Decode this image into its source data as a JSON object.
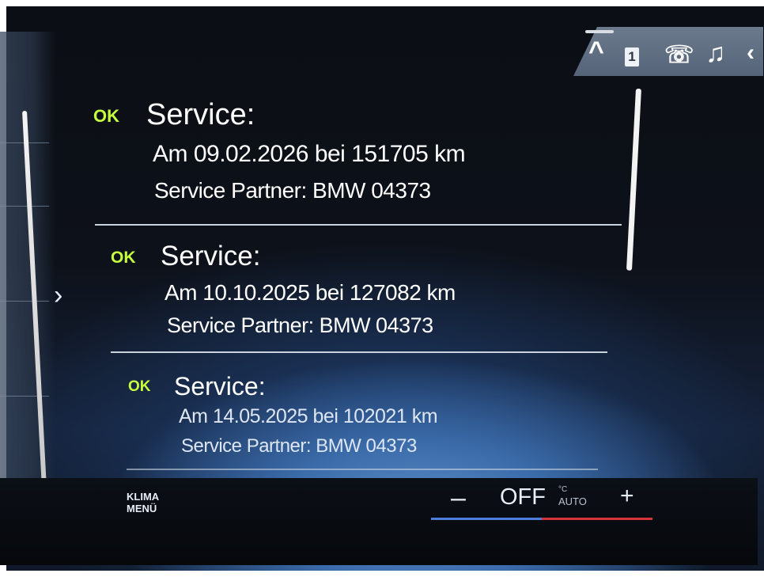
{
  "top_bar": {
    "icons": [
      "chevron-up-icon",
      "page-1-icon",
      "phone-icon",
      "music-icon"
    ],
    "page_indicator": "1"
  },
  "entries": [
    {
      "status": "OK",
      "title": "Service:",
      "line1": "Am 09.02.2026 bei 151705 km",
      "line2": "Service Partner: BMW 04373"
    },
    {
      "status": "OK",
      "title": "Service:",
      "line1": "Am 10.10.2025 bei 127082 km",
      "line2": "Service Partner: BMW 04373"
    },
    {
      "status": "OK",
      "title": "Service:",
      "line1": "Am 14.05.2025 bei 102021 km",
      "line2": "Service Partner: BMW 04373"
    }
  ],
  "bottom_bar": {
    "klima_line1": "KLIMA",
    "klima_line2": "MENÜ",
    "minus_label": "–",
    "plus_label": "+",
    "temp_value": "OFF",
    "temp_unit": "°C",
    "auto_label": "AUTO"
  },
  "colors": {
    "ok_green": "#c6ff3d",
    "temp_blue": "#4c7fdc",
    "temp_red": "#d8323a"
  }
}
